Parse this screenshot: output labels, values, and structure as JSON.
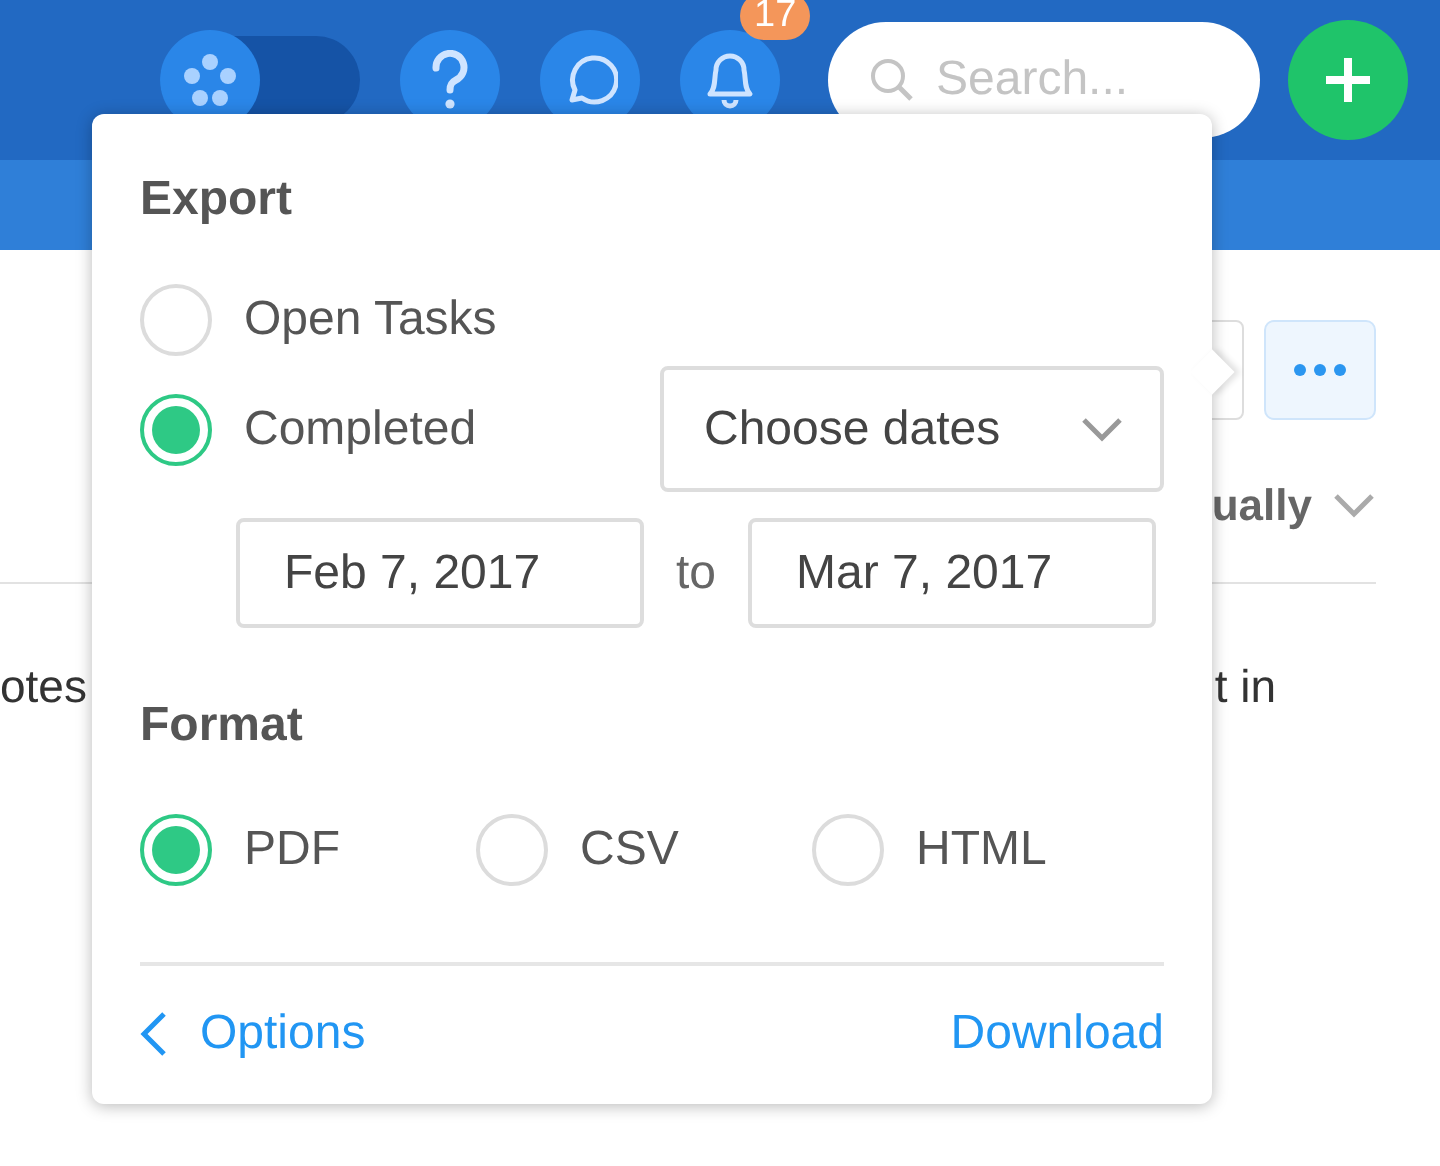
{
  "header": {
    "workspace_toggle": {
      "on": false
    },
    "notification_count": "17",
    "search": {
      "placeholder": "Search..."
    }
  },
  "background": {
    "sort_label": "ually",
    "text_left": "otes",
    "text_right": "t in"
  },
  "export": {
    "title": "Export",
    "scope_options": [
      {
        "label": "Open Tasks",
        "selected": false
      },
      {
        "label": "Completed",
        "selected": true
      }
    ],
    "date_range": {
      "label": "Choose dates",
      "from": "Feb 7, 2017",
      "joiner": "to",
      "to": "Mar 7, 2017"
    },
    "format_title": "Format",
    "formats": [
      {
        "label": "PDF",
        "selected": true
      },
      {
        "label": "CSV",
        "selected": false
      },
      {
        "label": "HTML",
        "selected": false
      }
    ],
    "back_link": "Options",
    "download": "Download"
  }
}
